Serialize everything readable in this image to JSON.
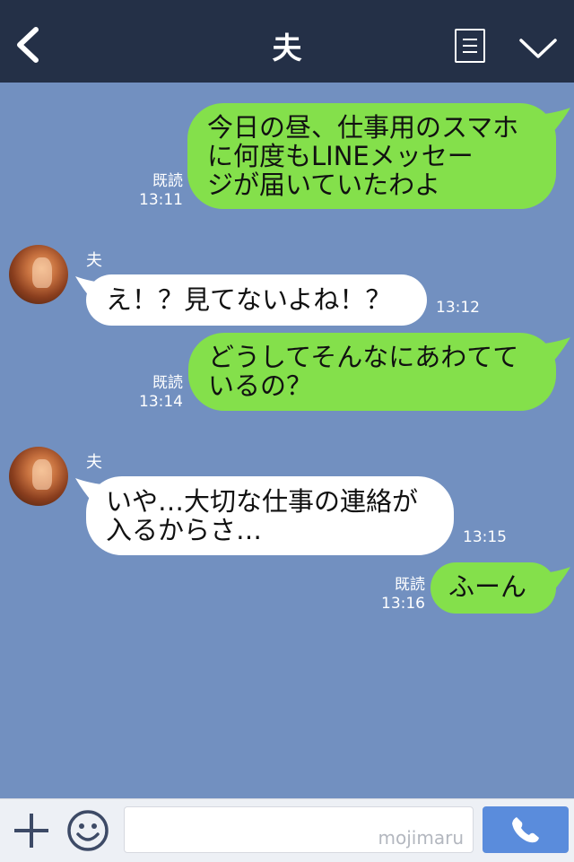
{
  "header": {
    "title": "夫"
  },
  "messages": [
    {
      "side": "right",
      "lines": [
        "今日の昼、仕事用のスマホ",
        "に何度もLINEメッセー",
        "ジが届いていたわよ"
      ],
      "read_label": "既読",
      "time": "13:11"
    },
    {
      "side": "left",
      "sender": "夫",
      "lines": [
        "え！？見てないよね！？"
      ],
      "time": "13:12"
    },
    {
      "side": "right",
      "lines": [
        "どうしてそんなにあわてて",
        "いるの？"
      ],
      "read_label": "既読",
      "time": "13:14"
    },
    {
      "side": "left",
      "sender": "夫",
      "lines": [
        "いや…大切な仕事の連絡が",
        "入るからさ…"
      ],
      "time": "13:15"
    },
    {
      "side": "right",
      "lines": [
        "ふーん"
      ],
      "read_label": "既読",
      "time": "13:16"
    }
  ],
  "input_bar": {
    "placeholder": "",
    "watermark": "mojimaru"
  },
  "colors": {
    "header_bg": "#243047",
    "chat_bg": "#7290c0",
    "my_bubble": "#84e04b",
    "their_bubble": "#ffffff",
    "call_button": "#5a8cdc"
  },
  "icons": [
    "back-arrow-icon",
    "menu-list-icon",
    "chevron-down-icon",
    "plus-icon",
    "emoji-icon",
    "phone-icon"
  ]
}
